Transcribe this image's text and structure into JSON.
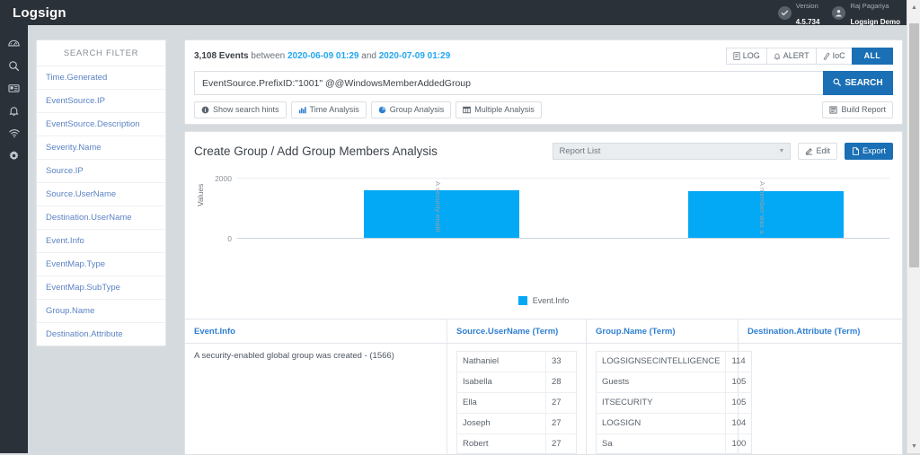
{
  "topbar": {
    "brand": "Logsign",
    "version_label": "Version",
    "version_value": "4.5.734",
    "user_name": "Raj Pagariya",
    "user_org": "Logsign Demo",
    "check_icon": "check-circle-icon",
    "user_icon": "user-avatar-icon"
  },
  "rail": {
    "items": [
      {
        "name": "dashboard-icon",
        "label": "Dashboard"
      },
      {
        "name": "search-icon",
        "label": "Search"
      },
      {
        "name": "reports-icon",
        "label": "Reports"
      },
      {
        "name": "alerts-bell-icon",
        "label": "Alerts"
      },
      {
        "name": "network-wifi-icon",
        "label": "Network"
      },
      {
        "name": "settings-gear-icon",
        "label": "Settings"
      }
    ]
  },
  "sidebar": {
    "header": "SEARCH FILTER",
    "items": [
      {
        "label": "Time.Generated"
      },
      {
        "label": "EventSource.IP"
      },
      {
        "label": "EventSource.Description"
      },
      {
        "label": "Severity.Name"
      },
      {
        "label": "Source.IP"
      },
      {
        "label": "Source.UserName"
      },
      {
        "label": "Destination.UserName"
      },
      {
        "label": "Event.Info"
      },
      {
        "label": "EventMap.Type"
      },
      {
        "label": "EventMap.SubType"
      },
      {
        "label": "Group.Name"
      },
      {
        "label": "Destination.Attribute"
      }
    ]
  },
  "search": {
    "event_count": "3,108 Events",
    "between_word": "between",
    "date_from": "2020-06-09 01:29",
    "and_word": "and",
    "date_to": "2020-07-09 01:29",
    "type_tabs": [
      {
        "label": "LOG",
        "icon": "log-file-icon",
        "active": false
      },
      {
        "label": "ALERT",
        "icon": "bell-icon",
        "active": false
      },
      {
        "label": "IoC",
        "icon": "ioc-icon",
        "active": false
      },
      {
        "label": "ALL",
        "icon": "",
        "active": true
      }
    ],
    "query_value": "EventSource.PrefixID:\"1001\" @@WindowsMemberAddedGroup",
    "query_placeholder": "Search query",
    "search_button": "SEARCH",
    "tools": [
      {
        "label": "Show search hints",
        "icon": "info-circle-icon"
      },
      {
        "label": "Time Analysis",
        "icon": "bar-chart-icon"
      },
      {
        "label": "Group Analysis",
        "icon": "pie-chart-icon"
      },
      {
        "label": "Multiple Analysis",
        "icon": "table-icon"
      }
    ],
    "build_report": {
      "label": "Build Report",
      "icon": "report-icon"
    }
  },
  "report": {
    "title": "Create Group / Add Group Members Analysis",
    "select_value": "Report List",
    "edit_label": "Edit",
    "export_label": "Export",
    "edit_icon": "edit-pencil-icon",
    "export_icon": "export-file-icon",
    "accent_color": "#1a6fb5",
    "bar_color": "#03a9f4"
  },
  "chart_data": {
    "type": "bar",
    "title": "Create Group / Add Group Members Analysis",
    "xlabel": "",
    "ylabel": "Values",
    "ylim": [
      0,
      2000
    ],
    "yticks": [
      0,
      2000
    ],
    "grid": true,
    "legend": [
      "Event.Info"
    ],
    "legend_position": "bottom",
    "categories": [
      "A security-enabl",
      "A member was a"
    ],
    "values": [
      1566,
      1542
    ],
    "series": [
      {
        "name": "Event.Info",
        "values": [
          1566,
          1542
        ]
      }
    ]
  },
  "tables": [
    {
      "header": "Event.Info",
      "kind": "text",
      "lines": [
        "A security-enabled global group was created - (1566)"
      ]
    },
    {
      "header": "Source.UserName (Term)",
      "kind": "terms",
      "rows": [
        {
          "term": "Nathaniel",
          "count": "33"
        },
        {
          "term": "Isabella",
          "count": "28"
        },
        {
          "term": "Ella",
          "count": "27"
        },
        {
          "term": "Joseph",
          "count": "27"
        },
        {
          "term": "Robert",
          "count": "27"
        }
      ]
    },
    {
      "header": "Group.Name (Term)",
      "kind": "terms",
      "rows": [
        {
          "term": "LOGSIGNSECINTELLIGENCE",
          "count": "114"
        },
        {
          "term": "Guests",
          "count": "105"
        },
        {
          "term": "ITSECURITY",
          "count": "105"
        },
        {
          "term": "LOGSIGN",
          "count": "104"
        },
        {
          "term": "Sa",
          "count": "100"
        }
      ]
    },
    {
      "header": "Destination.Attribute (Term)",
      "kind": "terms",
      "rows": []
    }
  ]
}
